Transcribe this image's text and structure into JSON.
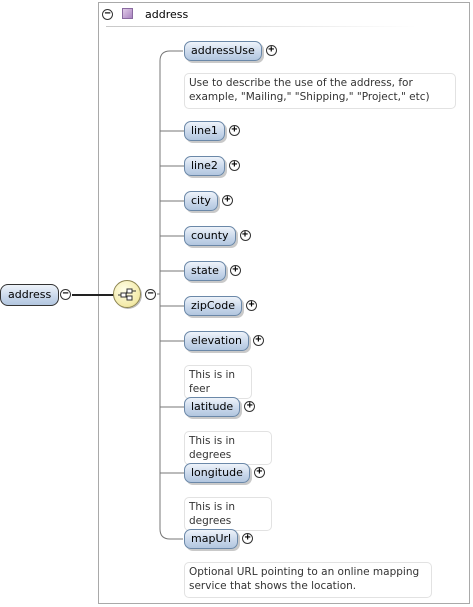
{
  "type_name": "address",
  "root_element": "address",
  "compositor": "sequence-icon",
  "children": [
    {
      "name": "addressUse",
      "note": "Use to describe the use of the address, for example, \"Mailing,\" \"Shipping,\" \"Project,\" etc)"
    },
    {
      "name": "line1"
    },
    {
      "name": "line2"
    },
    {
      "name": "city"
    },
    {
      "name": "county"
    },
    {
      "name": "state"
    },
    {
      "name": "zipCode"
    },
    {
      "name": "elevation",
      "note": "This is in feer"
    },
    {
      "name": "latitude",
      "note": "This is in degrees"
    },
    {
      "name": "longitude",
      "note": "This is in degrees"
    },
    {
      "name": "mapUrl",
      "note": "Optional URL pointing to an online mapping service that shows the location."
    }
  ]
}
